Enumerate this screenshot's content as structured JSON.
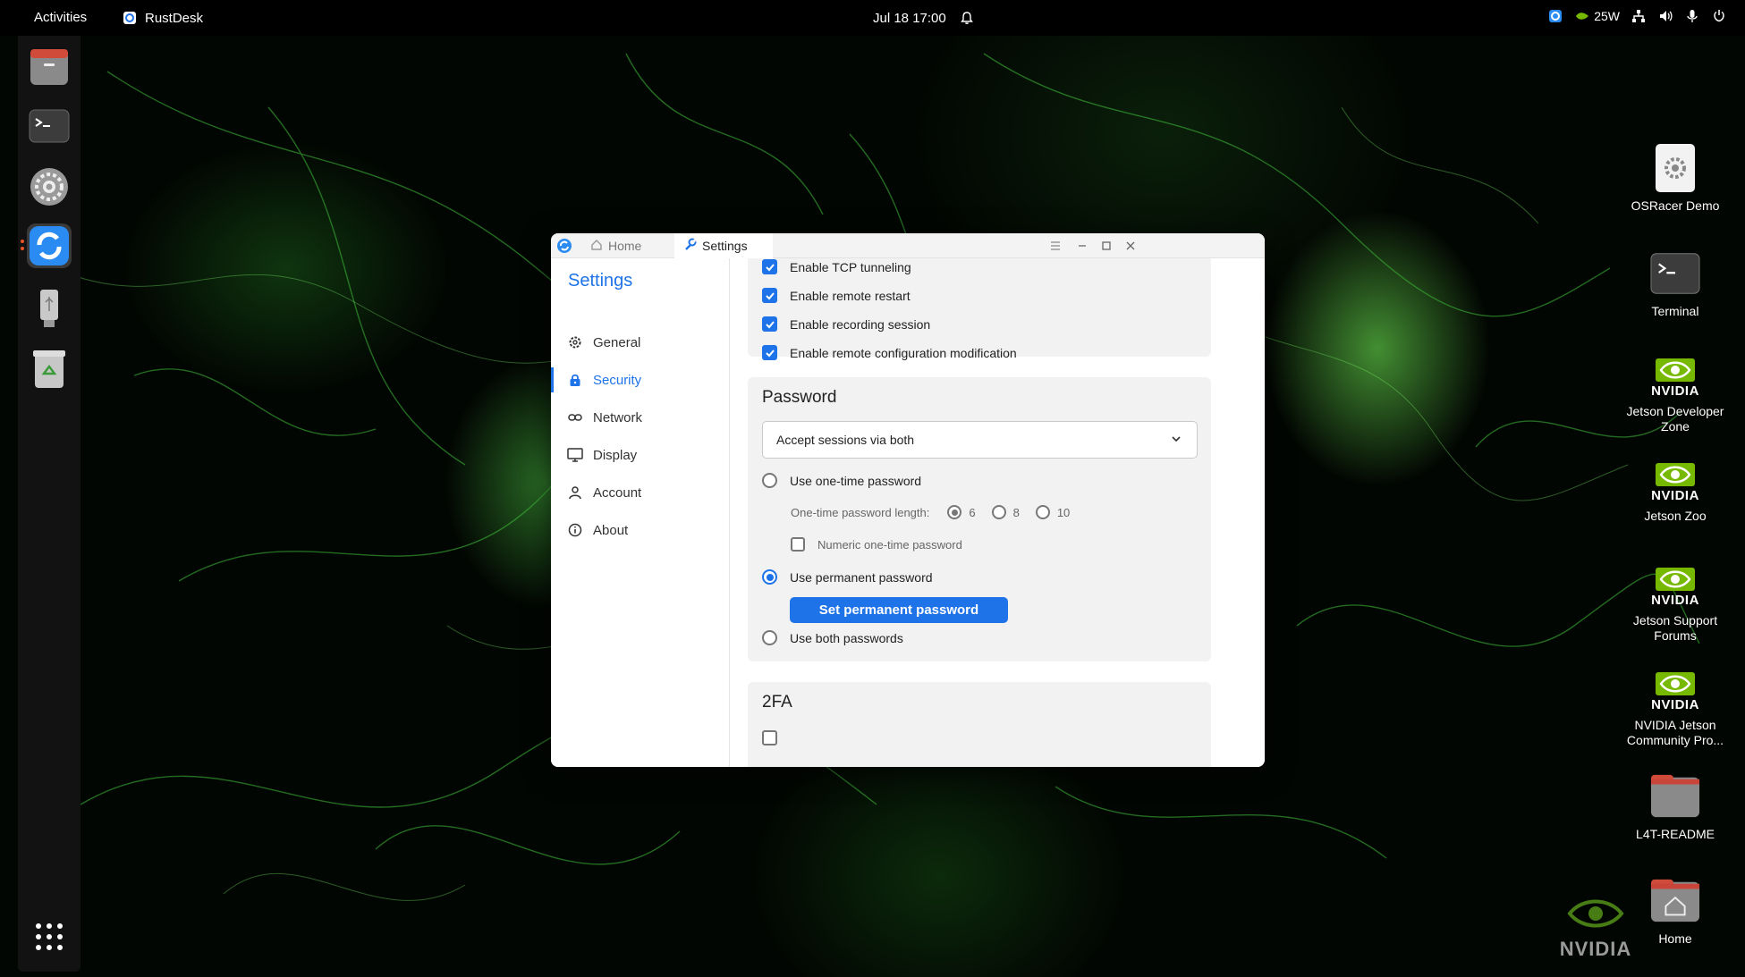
{
  "topbar": {
    "activities": "Activities",
    "app_name": "RustDesk",
    "datetime": "Jul 18  17:00",
    "power_label": "25W"
  },
  "dock": {
    "items": [
      "files-icon",
      "terminal-icon",
      "settings-icon",
      "rustdesk-icon",
      "usb-drive-icon",
      "trash-icon",
      "app-grid-icon"
    ]
  },
  "desktop_icons": [
    {
      "label": "OSRacer Demo",
      "icon": "gear-icon"
    },
    {
      "label": "Terminal",
      "icon": "terminal-icon"
    },
    {
      "label": "Jetson Developer Zone",
      "icon": "nvidia-icon"
    },
    {
      "label": "Jetson Zoo",
      "icon": "nvidia-icon"
    },
    {
      "label": "Jetson Support Forums",
      "icon": "nvidia-icon"
    },
    {
      "label": "NVIDIA Jetson Community Pro...",
      "icon": "nvidia-icon"
    },
    {
      "label": "L4T-README",
      "icon": "folder-icon"
    },
    {
      "label": "Home",
      "icon": "home-folder-icon"
    }
  ],
  "nvidia_logo_word": "NVIDIA",
  "window": {
    "tabs": [
      {
        "label": "Home",
        "icon": "home-icon"
      },
      {
        "label": "Settings",
        "icon": "wrench-icon"
      }
    ],
    "sidebar": {
      "title": "Settings",
      "items": [
        {
          "label": "General",
          "icon": "gear-icon"
        },
        {
          "label": "Security",
          "icon": "lock-icon"
        },
        {
          "label": "Network",
          "icon": "link-icon"
        },
        {
          "label": "Display",
          "icon": "monitor-icon"
        },
        {
          "label": "Account",
          "icon": "person-icon"
        },
        {
          "label": "About",
          "icon": "info-icon"
        }
      ],
      "active": "Security"
    },
    "permissions": [
      {
        "label": "Enable TCP tunneling",
        "checked": true
      },
      {
        "label": "Enable remote restart",
        "checked": true
      },
      {
        "label": "Enable recording session",
        "checked": true
      },
      {
        "label": "Enable remote configuration modification",
        "checked": true
      }
    ],
    "password": {
      "title": "Password",
      "dropdown_value": "Accept sessions via both",
      "use_one_time": "Use one-time password",
      "otp_length_label": "One-time password length:",
      "otp_lengths": [
        "6",
        "8",
        "10"
      ],
      "otp_selected": "6",
      "numeric_otp": "Numeric one-time password",
      "use_permanent": "Use permanent password",
      "set_permanent_button": "Set permanent password",
      "use_both": "Use both passwords",
      "selected_mode": "Use permanent password"
    },
    "twofa": {
      "title": "2FA"
    }
  },
  "colors": {
    "accent": "#1f73e8",
    "nvidia_green": "#76b900"
  }
}
